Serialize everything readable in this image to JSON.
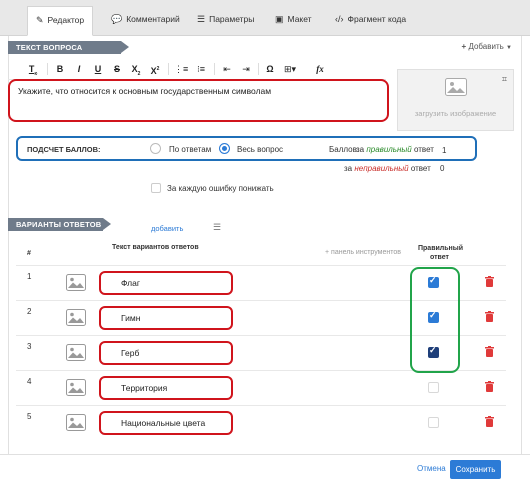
{
  "tabs": [
    {
      "label": "Редактор",
      "icon": "edit-icon",
      "active": true
    },
    {
      "label": "Комментарий",
      "icon": "comment-icon"
    },
    {
      "label": "Параметры",
      "icon": "sliders-icon"
    },
    {
      "label": "Макет",
      "icon": "save-icon"
    },
    {
      "label": "Фрагмент кода",
      "icon": "code-icon"
    }
  ],
  "question_section": {
    "title": "ТЕКСТ ВОПРОСА",
    "add_label": "Добавить",
    "text": "Укажите, что относится к основным государственным символам",
    "upload_label": "загрузить изображение"
  },
  "toolbar_icons": [
    "clear-format-icon",
    "bold-icon",
    "italic-icon",
    "underline-icon",
    "strikethrough-icon",
    "subscript-icon",
    "superscript-icon",
    "ordered-list-icon",
    "unordered-list-icon",
    "outdent-icon",
    "indent-icon",
    "special-char-icon",
    "table-icon",
    "formula-icon"
  ],
  "scoring": {
    "label": "ПОДСЧЕТ БАЛЛОВ:",
    "options": [
      "По ответам",
      "Весь вопрос"
    ],
    "selected": "Весь вопрос",
    "points_label": "Баллов:",
    "for_word": "за",
    "correct_word": "правильный",
    "incorrect_word": "неправильный",
    "answer_word": "ответ",
    "correct_points": "1",
    "incorrect_points": "0",
    "penalty_label": "За каждую ошибку понижать"
  },
  "answers_section": {
    "title": "ВАРИАНТЫ ОТВЕТОВ",
    "add_label": "добавить",
    "col_number": "#",
    "col_text": "Текст вариантов ответов",
    "col_toolbar": "+ панель инструментов",
    "col_correct_1": "Правильный",
    "col_correct_2": "ответ"
  },
  "answers": [
    {
      "n": "1",
      "text": "Флаг",
      "correct": true
    },
    {
      "n": "2",
      "text": "Гимн",
      "correct": true
    },
    {
      "n": "3",
      "text": "Герб",
      "correct": true
    },
    {
      "n": "4",
      "text": "Территория",
      "correct": false
    },
    {
      "n": "5",
      "text": "Национальные цвета",
      "correct": false
    }
  ],
  "footer": {
    "cancel_label": "Отмена",
    "save_label": "Сохранить"
  },
  "colors": {
    "accent": "#2c7bd6",
    "highlight_red": "#d0141c",
    "highlight_blue": "#1f6fb8",
    "highlight_green": "#21a44a",
    "ribbon": "#6f7b8a"
  }
}
